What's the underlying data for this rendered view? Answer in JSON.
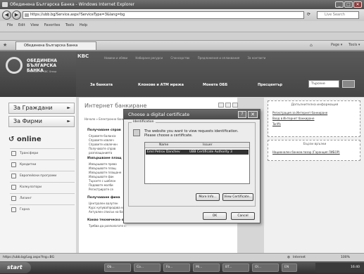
{
  "window": {
    "title": "Обединена Българска Банка - Windows Internet Explorer",
    "min": "_",
    "max": "□",
    "close": "✕"
  },
  "address": {
    "url": "https://ubb.bg/Service.aspx?ServiceType=3&lang=bg",
    "search_placeholder": "Live Search"
  },
  "menu": [
    "File",
    "Edit",
    "View",
    "Favorites",
    "Tools",
    "Help"
  ],
  "tab": {
    "label": "Обединена Българска Банка"
  },
  "bank": {
    "name_line1": "ОБЕДИНЕНА",
    "name_line2": "БЪЛГАРСКА",
    "name_line3": "БАНКА",
    "tagline": "A Member of KBC Group",
    "mark": "КВС"
  },
  "top_links": [
    "Новини и обяви",
    "Набиране ресурси",
    "Спонсорство",
    "Предложения и оплаквания",
    "За контакти"
  ],
  "main_nav": [
    "За банката",
    "Клонове и АТМ мрежа",
    "Монета ОББ",
    "Пресцентър"
  ],
  "site_search": {
    "placeholder": "Търсене"
  },
  "sidebar": {
    "sections": [
      {
        "label": "За Граждани"
      },
      {
        "label": "За Фирми"
      }
    ],
    "online": "online",
    "items": [
      {
        "label": "Трансфери"
      },
      {
        "label": "Кредитни"
      },
      {
        "label": "Европейски програми"
      },
      {
        "label": "Калкулатори"
      },
      {
        "label": "Лизинг"
      },
      {
        "label": "Горна"
      }
    ]
  },
  "center": {
    "title": "Интернет банкиране",
    "crumb": "Начало » Електронно банкиране",
    "sections": [
      {
        "heading": "Получаване справ",
        "bullets": [
          "Справете баланса",
          "Справете извлеч",
          "Справете извлечен",
          "Получавате справ",
          "разплащанията"
        ]
      },
      {
        "heading": "Извършване плащ",
        "bullets": [
          "Извършвате прево",
          "Извършвате плащ",
          "Извършвате плащане",
          "Извършвате фак",
          "Търсите с шаблон",
          "Подавате молби",
          "Регистрирате се"
        ]
      },
      {
        "heading": "Получаване фина",
        "bullets": [
          "Централен валутен",
          "Курс купува/продава на ОББ за всякакви валути",
          "Актуален списък на банките, участващи в БИСЕРА"
        ]
      },
      {
        "heading": "Какво техническо оборудване Ви е необходимо?",
        "bullets": [
          "Трябва да разполагате с:"
        ]
      }
    ]
  },
  "right": {
    "box1_title": "Допълнителна информация",
    "box1_links": [
      "Регистрация за Интернет банкиране",
      "Вход в Интернет банкиране",
      "Tariffs"
    ],
    "box2_title": "Бързи връзки",
    "box2_links": [
      "Национален банков пазар (Гаранция ЛИБОР)"
    ]
  },
  "dialog": {
    "title": "Choose a digital certificate",
    "help": "?",
    "close": "✕",
    "group_label": "Identification",
    "message": "The website you want to view requests identification. Please choose a certificate.",
    "columns": [
      "Name",
      "Issuer"
    ],
    "rows": [
      {
        "name": "Emil Petrov Danchev",
        "issuer": "UBB Certificate Authority 3"
      }
    ],
    "more_info": "More Info...",
    "view_cert": "View Certificate...",
    "ok": "OK",
    "cancel": "Cancel"
  },
  "status": {
    "url": "https://ubb.bg/Log.aspx?lng=BG",
    "zone": "Internet",
    "zoom": "100%"
  },
  "taskbar": {
    "start": "start",
    "items": [
      "Ob...",
      "Co...",
      "Fo...",
      "Mi...",
      "BT...",
      "Ol...",
      "EN"
    ],
    "time": "16:40"
  }
}
